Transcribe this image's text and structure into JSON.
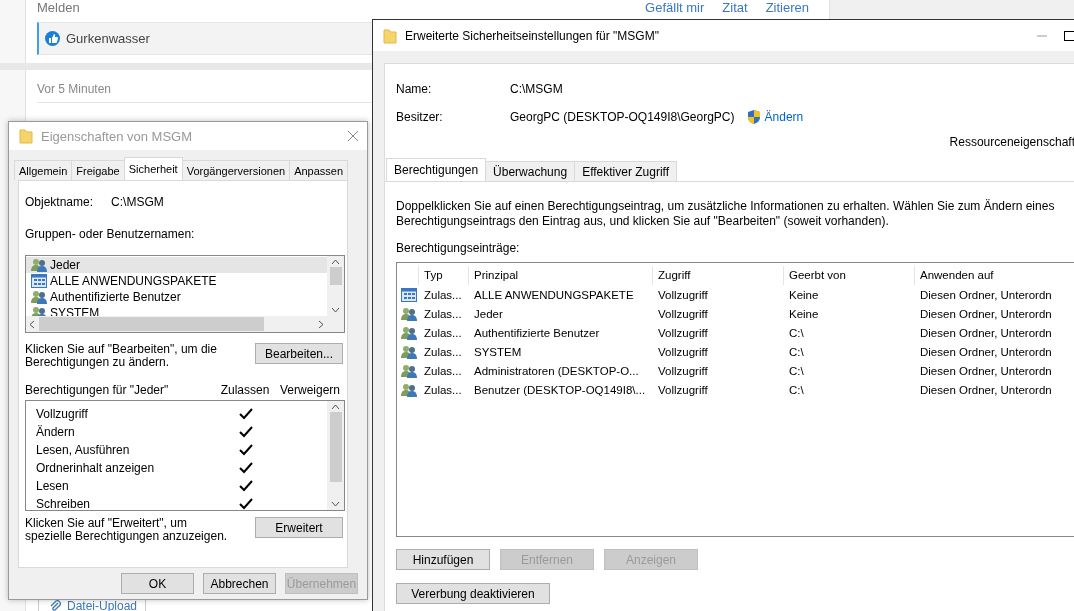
{
  "background_page": {
    "report_link": "Melden",
    "post_actions": [
      "Gefällt mir",
      "Zitat",
      "Zitieren"
    ],
    "liked_by": "Gurkenwasser",
    "timestamp": "Vor 5 Minuten",
    "upload_button": "Datei-Upload"
  },
  "properties_dialog": {
    "title": "Eigenschaften von MSGM",
    "tabs": [
      {
        "label": "Allgemein",
        "selected": false
      },
      {
        "label": "Freigabe",
        "selected": false
      },
      {
        "label": "Sicherheit",
        "selected": true
      },
      {
        "label": "Vorgängerversionen",
        "selected": false
      },
      {
        "label": "Anpassen",
        "selected": false
      }
    ],
    "object_name_label": "Objektname:",
    "object_name": "C:\\MSGM",
    "groups_label": "Gruppen- oder Benutzernamen:",
    "groups": [
      {
        "name": "Jeder",
        "kind": "group",
        "selected": true
      },
      {
        "name": "ALLE ANWENDUNGSPAKETE",
        "kind": "package",
        "selected": false
      },
      {
        "name": "Authentifizierte Benutzer",
        "kind": "group",
        "selected": false
      },
      {
        "name": "SYSTEM",
        "kind": "group",
        "selected": false
      }
    ],
    "edit_hint": "Klicken Sie auf \"Bearbeiten\", um die Berechtigungen zu ändern.",
    "edit_button": "Bearbeiten...",
    "permissions_label": "Berechtigungen für \"Jeder\"",
    "allow_header": "Zulassen",
    "deny_header": "Verweigern",
    "permissions": [
      {
        "name": "Vollzugriff",
        "allow": true
      },
      {
        "name": "Ändern",
        "allow": true
      },
      {
        "name": "Lesen, Ausführen",
        "allow": true
      },
      {
        "name": "Ordnerinhalt anzeigen",
        "allow": true
      },
      {
        "name": "Lesen",
        "allow": true
      },
      {
        "name": "Schreiben",
        "allow": true
      }
    ],
    "advanced_hint": "Klicken Sie auf \"Erweitert\", um spezielle Berechtigungen anzuzeigen.",
    "advanced_button": "Erweitert",
    "buttons": [
      {
        "label": "OK",
        "disabled": false
      },
      {
        "label": "Abbrechen",
        "disabled": false
      },
      {
        "label": "Übernehmen",
        "disabled": true
      }
    ]
  },
  "advanced_dialog": {
    "title": "Erweiterte Sicherheitseinstellungen für \"MSGM\"",
    "name_label": "Name:",
    "name": "C:\\MSGM",
    "owner_label": "Besitzer:",
    "owner": "GeorgPC (DESKTOP-OQ149I8\\GeorgPC)",
    "change_link": "Ändern",
    "resource_properties": "Ressourceneigenschaft",
    "tabs": [
      {
        "label": "Berechtigungen",
        "selected": true
      },
      {
        "label": "Überwachung",
        "selected": false
      },
      {
        "label": "Effektiver Zugriff",
        "selected": false
      }
    ],
    "instructions": "Doppelklicken Sie auf einen Berechtigungseintrag, um zusätzliche Informationen zu erhalten. Wählen Sie zum Ändern eines Berechtigungseintrags den Eintrag aus, und klicken Sie auf \"Bearbeiten\" (soweit vorhanden).",
    "entries_label": "Berechtigungseinträge:",
    "table": {
      "columns": [
        "Typ",
        "Prinzipal",
        "Zugriff",
        "Geerbt von",
        "Anwenden auf"
      ],
      "rows": [
        {
          "kind": "package",
          "type": "Zulas...",
          "principal": "ALLE ANWENDUNGSPAKETE",
          "access": "Vollzugriff",
          "inherited_from": "Keine",
          "applies_to": "Diesen Ordner, Unterordn"
        },
        {
          "kind": "group",
          "type": "Zulas...",
          "principal": "Jeder",
          "access": "Vollzugriff",
          "inherited_from": "Keine",
          "applies_to": "Diesen Ordner, Unterordn"
        },
        {
          "kind": "group",
          "type": "Zulas...",
          "principal": "Authentifizierte Benutzer",
          "access": "Vollzugriff",
          "inherited_from": "C:\\",
          "applies_to": "Diesen Ordner, Unterordn"
        },
        {
          "kind": "group",
          "type": "Zulas...",
          "principal": "SYSTEM",
          "access": "Vollzugriff",
          "inherited_from": "C:\\",
          "applies_to": "Diesen Ordner, Unterordn"
        },
        {
          "kind": "group",
          "type": "Zulas...",
          "principal": "Administratoren (DESKTOP-O...",
          "access": "Vollzugriff",
          "inherited_from": "C:\\",
          "applies_to": "Diesen Ordner, Unterordn"
        },
        {
          "kind": "group",
          "type": "Zulas...",
          "principal": "Benutzer (DESKTOP-OQ149I8\\...",
          "access": "Vollzugriff",
          "inherited_from": "C:\\",
          "applies_to": "Diesen Ordner, Unterordn"
        }
      ]
    },
    "buttons": [
      {
        "label": "Hinzufügen",
        "disabled": false
      },
      {
        "label": "Entfernen",
        "disabled": true
      },
      {
        "label": "Anzeigen",
        "disabled": true
      }
    ],
    "inheritance_button": "Vererbung deaktivieren"
  }
}
